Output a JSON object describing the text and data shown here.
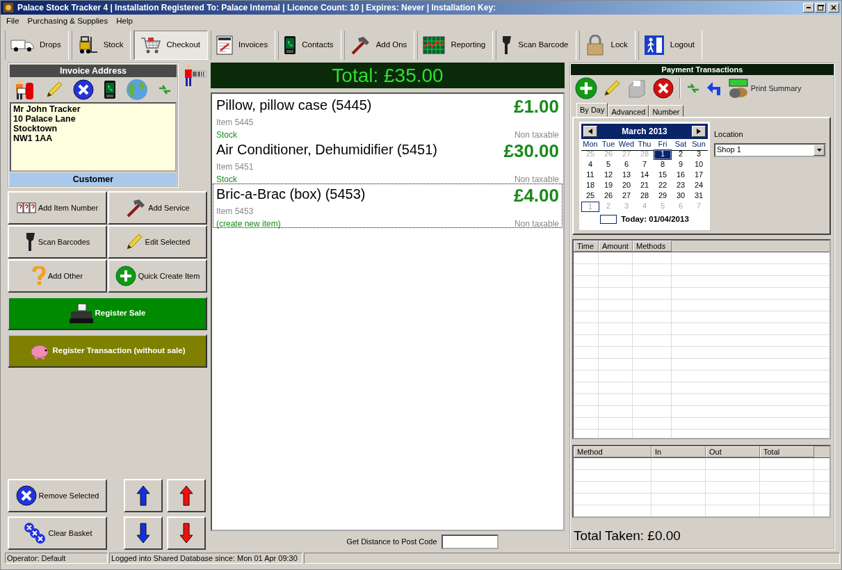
{
  "window": {
    "title": "Palace Stock Tracker 4 | Installation Registered To: Palace Internal | Licence Count: 10 | Expires: Never | Installation Key:"
  },
  "menu": [
    {
      "label": "File"
    },
    {
      "label": "Purchasing & Supplies"
    },
    {
      "label": "Help"
    }
  ],
  "toolbar": [
    {
      "label": "Drops",
      "selected": false
    },
    {
      "label": "Stock",
      "selected": false
    },
    {
      "label": "Checkout",
      "selected": true
    },
    {
      "label": "Invoices",
      "selected": false
    },
    {
      "label": "Contacts",
      "selected": false
    },
    {
      "label": "Add Ons",
      "selected": false
    },
    {
      "label": "Reporting",
      "selected": false
    },
    {
      "label": "Scan Barcode",
      "selected": false
    },
    {
      "label": "Lock",
      "selected": false
    },
    {
      "label": "Logout",
      "selected": false
    }
  ],
  "invoice_address": {
    "title": "Invoice Address",
    "lines": [
      "Mr John Tracker",
      "10 Palace Lane",
      "Stocktown",
      "NW1 1AA"
    ],
    "footer": "Customer"
  },
  "item_actions": [
    {
      "label": "Add Item Number"
    },
    {
      "label": "Add Service"
    },
    {
      "label": "Scan Barcodes"
    },
    {
      "label": "Edit Selected"
    },
    {
      "label": "Add Other"
    },
    {
      "label": "Quick Create Item"
    }
  ],
  "register_buttons": [
    {
      "label": "Register Sale",
      "kind": "sale"
    },
    {
      "label": "Register Transaction (without sale)",
      "kind": "transaction"
    }
  ],
  "basket_actions": [
    {
      "label": "Remove Selected"
    },
    {
      "label": "Clear Basket"
    }
  ],
  "total": "Total: £35.00",
  "basket": [
    {
      "name": "Pillow, pillow case (5445)",
      "price": "£1.00",
      "item": "Item 5445",
      "category": "Stock",
      "tax": "Non taxable",
      "selected": false
    },
    {
      "name": "Air Conditioner, Dehumidifier (5451)",
      "price": "£30.00",
      "item": "Item 5451",
      "category": "Stock",
      "tax": "Non taxable",
      "selected": false
    },
    {
      "name": "Bric-a-Brac (box) (5453)",
      "price": "£4.00",
      "item": "Item 5453",
      "category": "(create new item)",
      "tax": "Non taxable",
      "selected": true
    }
  ],
  "distance": {
    "label": "Get Distance to Post Code"
  },
  "payments": {
    "title": "Payment Transactions",
    "print_label": "Print Summary",
    "tabs": [
      {
        "label": "By Day",
        "selected": true
      },
      {
        "label": "Advanced",
        "selected": false
      },
      {
        "label": "Number",
        "selected": false
      }
    ],
    "calendar": {
      "month": "March 2013",
      "weekdays": [
        "Mon",
        "Tue",
        "Wed",
        "Thu",
        "Fri",
        "Sat",
        "Sun"
      ],
      "weeks": [
        [
          {
            "day": "25",
            "other": true,
            "selected": false,
            "today": false
          },
          {
            "day": "26",
            "other": true,
            "selected": false,
            "today": false
          },
          {
            "day": "27",
            "other": true,
            "selected": false,
            "today": false
          },
          {
            "day": "28",
            "other": true,
            "selected": false,
            "today": false
          },
          {
            "day": "1",
            "other": false,
            "selected": true,
            "today": false
          },
          {
            "day": "2",
            "other": false,
            "selected": false,
            "today": false
          },
          {
            "day": "3",
            "other": false,
            "selected": false,
            "today": false
          }
        ],
        [
          {
            "day": "4",
            "other": false,
            "selected": false,
            "today": false
          },
          {
            "day": "5",
            "other": false,
            "selected": false,
            "today": false
          },
          {
            "day": "6",
            "other": false,
            "selected": false,
            "today": false
          },
          {
            "day": "7",
            "other": false,
            "selected": false,
            "today": false
          },
          {
            "day": "8",
            "other": false,
            "selected": false,
            "today": false
          },
          {
            "day": "9",
            "other": false,
            "selected": false,
            "today": false
          },
          {
            "day": "10",
            "other": false,
            "selected": false,
            "today": false
          }
        ],
        [
          {
            "day": "11",
            "other": false,
            "selected": false,
            "today": false
          },
          {
            "day": "12",
            "other": false,
            "selected": false,
            "today": false
          },
          {
            "day": "13",
            "other": false,
            "selected": false,
            "today": false
          },
          {
            "day": "14",
            "other": false,
            "selected": false,
            "today": false
          },
          {
            "day": "15",
            "other": false,
            "selected": false,
            "today": false
          },
          {
            "day": "16",
            "other": false,
            "selected": false,
            "today": false
          },
          {
            "day": "17",
            "other": false,
            "selected": false,
            "today": false
          }
        ],
        [
          {
            "day": "18",
            "other": false,
            "selected": false,
            "today": false
          },
          {
            "day": "19",
            "other": false,
            "selected": false,
            "today": false
          },
          {
            "day": "20",
            "other": false,
            "selected": false,
            "today": false
          },
          {
            "day": "21",
            "other": false,
            "selected": false,
            "today": false
          },
          {
            "day": "22",
            "other": false,
            "selected": false,
            "today": false
          },
          {
            "day": "23",
            "other": false,
            "selected": false,
            "today": false
          },
          {
            "day": "24",
            "other": false,
            "selected": false,
            "today": false
          }
        ],
        [
          {
            "day": "25",
            "other": false,
            "selected": false,
            "today": false
          },
          {
            "day": "26",
            "other": false,
            "selected": false,
            "today": false
          },
          {
            "day": "27",
            "other": false,
            "selected": false,
            "today": false
          },
          {
            "day": "28",
            "other": false,
            "selected": false,
            "today": false
          },
          {
            "day": "29",
            "other": false,
            "selected": false,
            "today": false
          },
          {
            "day": "30",
            "other": false,
            "selected": false,
            "today": false
          },
          {
            "day": "31",
            "other": false,
            "selected": false,
            "today": false
          }
        ],
        [
          {
            "day": "1",
            "other": true,
            "selected": false,
            "today": true
          },
          {
            "day": "2",
            "other": true,
            "selected": false,
            "today": false
          },
          {
            "day": "3",
            "other": true,
            "selected": false,
            "today": false
          },
          {
            "day": "4",
            "other": true,
            "selected": false,
            "today": false
          },
          {
            "day": "5",
            "other": true,
            "selected": false,
            "today": false
          },
          {
            "day": "6",
            "other": true,
            "selected": false,
            "today": false
          },
          {
            "day": "7",
            "other": true,
            "selected": false,
            "today": false
          }
        ]
      ],
      "today": "Today: 01/04/2013"
    },
    "location": {
      "label": "Location",
      "value": "Shop 1"
    },
    "transactions": {
      "columns": [
        "Time",
        "Amount",
        "Methods"
      ]
    },
    "summary": {
      "columns": [
        "Method",
        "In",
        "Out",
        "Total"
      ]
    },
    "total_taken": "Total Taken: £0.00"
  },
  "status_bar": [
    "Operator: Default",
    "Logged into Shared Database since: Mon 01 Apr 09:30"
  ]
}
